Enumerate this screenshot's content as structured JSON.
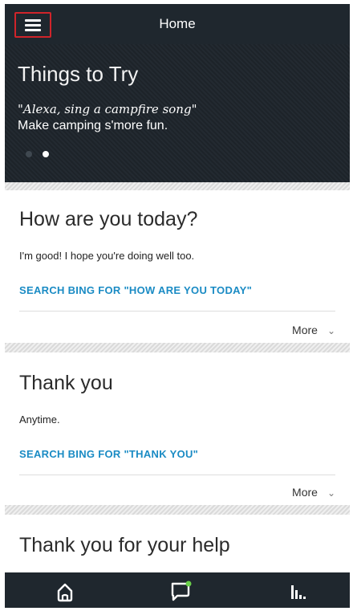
{
  "header": {
    "title": "Home"
  },
  "hero": {
    "title": "Things to Try",
    "quote": "\"Alexa, sing a campfire song\"",
    "subtitle": "Make camping s'more fun.",
    "active_dot": 2,
    "dot_count": 2
  },
  "cards": [
    {
      "title": "How are you today?",
      "response": "I'm good! I hope you're doing well too.",
      "search_link": "SEARCH BING FOR \"HOW ARE YOU TODAY\"",
      "more_label": "More"
    },
    {
      "title": "Thank you",
      "response": "Anytime.",
      "search_link": "SEARCH BING FOR \"THANK YOU\"",
      "more_label": "More"
    },
    {
      "title": "Thank you for your help"
    }
  ],
  "bottom_nav": {
    "items": [
      "home-icon",
      "chat-icon",
      "music-icon"
    ],
    "chat_notification_color": "#6ad04a"
  },
  "colors": {
    "accent_link": "#1a8bc4",
    "header_bg": "#1f272e",
    "menu_highlight": "#d0242a"
  }
}
